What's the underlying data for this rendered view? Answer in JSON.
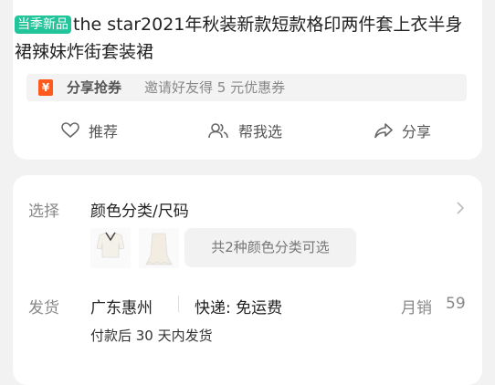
{
  "product": {
    "tag": "当季新品",
    "title": "the star2021年秋装新款短款格印两件套上衣半身裙辣妹炸街套装裙"
  },
  "share": {
    "icon": "coupon-icon",
    "coupon_glyph": "¥",
    "title": "分享抢券",
    "desc": "邀请好友得 5 元优惠券"
  },
  "actions": [
    {
      "icon": "heart-icon",
      "label": "推荐"
    },
    {
      "icon": "people-icon",
      "label": "帮我选"
    },
    {
      "icon": "share-icon",
      "label": "分享"
    }
  ],
  "select": {
    "label": "选择",
    "value": "颜色分类/尺码",
    "options_hint": "共2种颜色分类可选"
  },
  "shipping": {
    "label": "发货",
    "origin": "广东惠州",
    "express": "快递: 免运费",
    "sales_label": "月销",
    "sales_value": "59",
    "note": "付款后 30 天内发货"
  },
  "colors": {
    "accent_green": "#22c49a",
    "coupon_orange": "#ff5a1e"
  }
}
